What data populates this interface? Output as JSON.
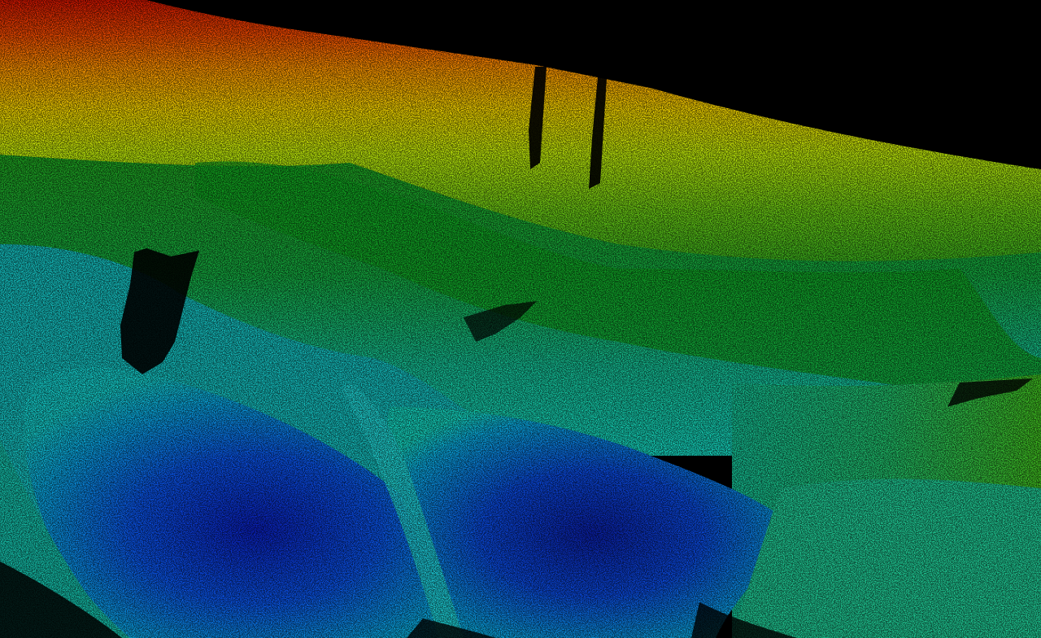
{
  "scene": {
    "background": "#000000",
    "colormap": [
      "#0000b4",
      "#0a46dc",
      "#0aa0d2",
      "#14c8b4",
      "#1eb464",
      "#14a028",
      "#50b414",
      "#a0d20a",
      "#e6d200",
      "#f08c00",
      "#dc3200",
      "#c81400"
    ]
  }
}
